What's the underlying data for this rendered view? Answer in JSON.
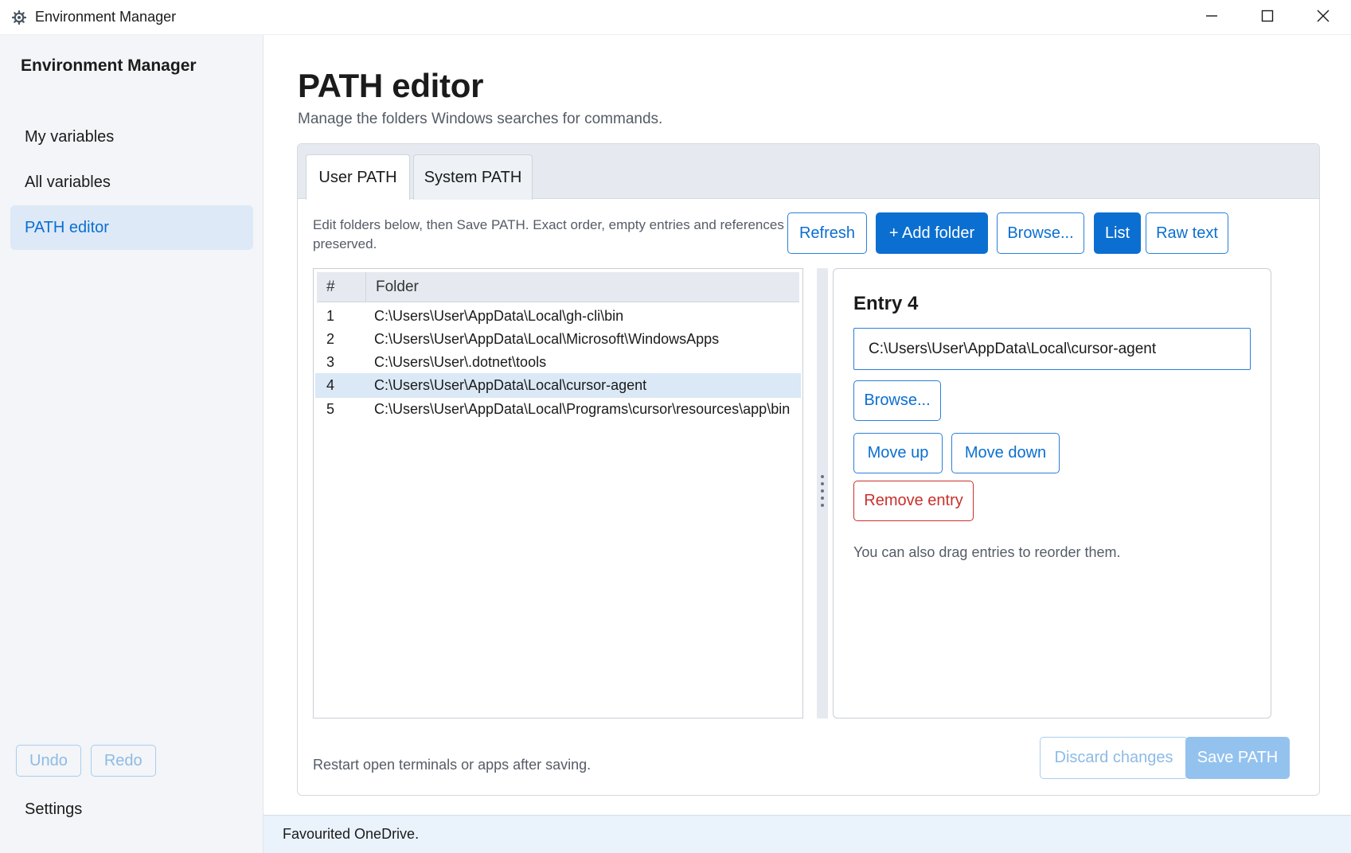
{
  "window": {
    "title": "Environment Manager",
    "icon": "gear-icon"
  },
  "sidebar": {
    "title": "Environment Manager",
    "items": [
      {
        "label": "My variables",
        "active": false
      },
      {
        "label": "All variables",
        "active": false
      },
      {
        "label": "PATH editor",
        "active": true
      }
    ],
    "undo_label": "Undo",
    "redo_label": "Redo",
    "settings_label": "Settings"
  },
  "page": {
    "title": "PATH editor",
    "subtitle": "Manage the folders Windows searches for commands."
  },
  "tabs": [
    {
      "label": "User PATH",
      "active": true
    },
    {
      "label": "System PATH",
      "active": false
    }
  ],
  "toolbar": {
    "hint": "Edit folders below, then Save PATH. Exact order, empty entries and references are preserved.",
    "refresh_label": "Refresh",
    "add_folder_label": "+ Add folder",
    "browse_label": "Browse...",
    "list_label": "List",
    "raw_text_label": "Raw text"
  },
  "table": {
    "headers": [
      "#",
      "Folder"
    ],
    "rows": [
      {
        "num": "1",
        "folder": "C:\\Users\\User\\AppData\\Local\\gh-cli\\bin"
      },
      {
        "num": "2",
        "folder": "C:\\Users\\User\\AppData\\Local\\Microsoft\\WindowsApps"
      },
      {
        "num": "3",
        "folder": "C:\\Users\\User\\.dotnet\\tools"
      },
      {
        "num": "4",
        "folder": "C:\\Users\\User\\AppData\\Local\\cursor-agent"
      },
      {
        "num": "5",
        "folder": "C:\\Users\\User\\AppData\\Local\\Programs\\cursor\\resources\\app\\bin"
      }
    ],
    "selected_index": 3
  },
  "detail": {
    "title": "Entry 4",
    "value": "C:\\Users\\User\\AppData\\Local\\cursor-agent",
    "browse_label": "Browse...",
    "move_up_label": "Move up",
    "move_down_label": "Move down",
    "remove_label": "Remove entry",
    "drag_hint": "You can also drag entries to reorder them."
  },
  "footer": {
    "hint": "Restart open terminals or apps after saving.",
    "discard_label": "Discard changes",
    "save_label": "Save PATH"
  },
  "status": {
    "text": "Favourited OneDrive."
  },
  "colors": {
    "accent": "#0b6fd1",
    "danger": "#c9302c",
    "selected_row": "#dbe8f6",
    "sidebar_bg": "#f3f5f8"
  }
}
